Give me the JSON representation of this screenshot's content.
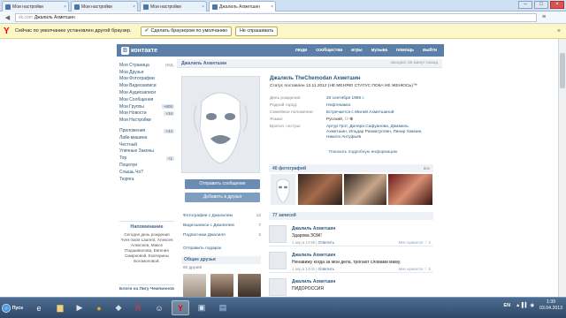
{
  "browser": {
    "tabs": [
      {
        "label": "Мои настройки",
        "active": false
      },
      {
        "label": "Мои настройки",
        "active": false
      },
      {
        "label": "Мои настройки",
        "active": false
      },
      {
        "label": "Джалиль Ахметшин",
        "active": true
      }
    ],
    "url_domain": "vk.com",
    "url_title": "Джалиль Ахметшин",
    "infobar_message": "Сейчас по умолчанию установлен другой браузер.",
    "infobar_btn_default": "Сделать браузером по умолчанию",
    "infobar_btn_dont_ask": "Не спрашивать"
  },
  "vk": {
    "logo_letter": "В",
    "logo_text": "контакте",
    "nav": [
      "люди",
      "сообщества",
      "игры",
      "музыка",
      "помощь",
      "выйти"
    ],
    "left_menu": [
      {
        "label": "Моя Страница",
        "tag": "ред."
      },
      {
        "label": "Мои Друзья",
        "tag": ""
      },
      {
        "label": "Мои Фотографии",
        "tag": ""
      },
      {
        "label": "Мои Видеозаписи",
        "tag": ""
      },
      {
        "label": "Мои Аудиозаписи",
        "tag": ""
      },
      {
        "label": "Мои Сообщения",
        "tag": ""
      },
      {
        "label": "Мои Группы",
        "tag": "+605"
      },
      {
        "label": "Мои Новости",
        "tag": "+34"
      },
      {
        "label": "Мои Настройки",
        "tag": ""
      }
    ],
    "left_menu2": [
      {
        "label": "Приложения",
        "tag": "+44"
      },
      {
        "label": "Лайк-машина",
        "tag": ""
      },
      {
        "label": "Честный",
        "tag": ""
      },
      {
        "label": "Уличные Законы",
        "tag": ""
      },
      {
        "label": "Тор",
        "tag": "+1"
      },
      {
        "label": "Поцелуи",
        "tag": ""
      },
      {
        "label": "Слышь Чо?",
        "tag": ""
      },
      {
        "label": "Тюряга",
        "tag": ""
      }
    ],
    "reminder_title": "Напоминание",
    "reminder_text": "Сегодня день рождения Yves-Saint Laurent, Алексея Алексеев, Максе Подшивалова, Евгения Смирновой, Екатерины Богомоловой.",
    "blogs": "Блоги на Лигу Чемпионов"
  },
  "profile": {
    "bar_name": "Джалиль Ахметшин",
    "bar_online": "заходил 38 минут назад",
    "name": "Джалиль TheChemodan Ахметшин",
    "status": "Статус поставлен 13.11.2012 (НЕ МЕНЯЮ СТАТУС ПОКА НЕ ЖЕНЮСЬ)™",
    "info": [
      {
        "key": "День рождения:",
        "val": "20 сентября 1996 г."
      },
      {
        "key": "Родной город:",
        "val": "Нефтекамск"
      },
      {
        "key": "Семейное положение:",
        "val": "встречается с Милей Ахметшиной"
      },
      {
        "key": "Языки:",
        "val": "Русский, ⚆ ⊕"
      },
      {
        "key": "Братья, сестры:",
        "val": "Артур Грот, Диляра Сафуанова, Джамиль Ахметшин, Ильдар Разматуллин, Линар Хамзин, Никита Антуфьев"
      }
    ],
    "show_more": "Показать подробную информацию",
    "btn_message": "Отправить сообщение",
    "btn_add": "Добавить в друзья",
    "links": [
      {
        "label": "Фотографии с Джалилем",
        "count": "12"
      },
      {
        "label": "Видеозаписи с Джалилем",
        "count": "7"
      },
      {
        "label": "Подписчики Джалиля",
        "count": "2"
      },
      {
        "label": "Отправить подарок",
        "count": ""
      }
    ],
    "friends_title": "Общие друзья",
    "friends_sub": "60 друзей",
    "photos_title": "40 фотографий",
    "photos_all": "все",
    "wall_title": "77 записей",
    "posts": [
      {
        "author": "Джалиль Ахметшин",
        "text": "Здарова ЗОЖ!",
        "date": "1 апр в 14:59",
        "reply": "Ответить",
        "likes": "Мне нравится ♡ 2"
      },
      {
        "author": "Джалиль Ахметшин",
        "text": "Ненавижу когда за мои дела, трогают словами маму.",
        "date": "1 апр в 14:01",
        "reply": "Ответить",
        "likes": "Мне нравится ♡ 5"
      },
      {
        "author": "Джалиль Ахметшин",
        "text": "ПИДОРОССИЯ",
        "date": "",
        "reply": "",
        "likes": ""
      }
    ]
  },
  "taskbar": {
    "start": "Пуск",
    "lang": "EN",
    "time": "1:39",
    "date": "03.04.2013"
  }
}
